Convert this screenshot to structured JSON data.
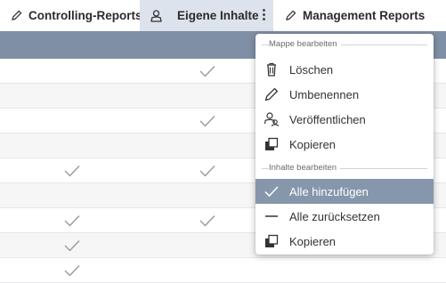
{
  "tabs": [
    {
      "label": "Controlling-Reports",
      "icon": "pencil-icon",
      "active": false
    },
    {
      "label": "Eigene Inhalte",
      "icon": "user-icon",
      "active": true
    },
    {
      "label": "Management Reports",
      "icon": "pencil-icon",
      "active": false
    }
  ],
  "grid": {
    "rows": [
      {
        "col1_checked": false,
        "col2_checked": true
      },
      {
        "col1_checked": false,
        "col2_checked": false
      },
      {
        "col1_checked": false,
        "col2_checked": true
      },
      {
        "col1_checked": false,
        "col2_checked": false
      },
      {
        "col1_checked": true,
        "col2_checked": true
      },
      {
        "col1_checked": false,
        "col2_checked": false
      },
      {
        "col1_checked": true,
        "col2_checked": true
      },
      {
        "col1_checked": true,
        "col2_checked": false
      },
      {
        "col1_checked": true,
        "col2_checked": false
      }
    ]
  },
  "menu": {
    "section1_title": "Mappe bearbeiten",
    "section1_items": [
      {
        "label": "Löschen",
        "icon": "trash-icon"
      },
      {
        "label": "Umbenennen",
        "icon": "pencil-icon"
      },
      {
        "label": "Veröffentlichen",
        "icon": "share-users-icon"
      },
      {
        "label": "Kopieren",
        "icon": "copy-icon"
      }
    ],
    "section2_title": "Inhalte bearbeiten",
    "section2_items": [
      {
        "label": "Alle hinzufügen",
        "icon": "check-icon",
        "selected": true
      },
      {
        "label": "Alle zurücksetzen",
        "icon": "minus-icon",
        "selected": false
      },
      {
        "label": "Kopieren",
        "icon": "copy-icon",
        "selected": false
      }
    ]
  },
  "colors": {
    "header_bg": "#7f8fa5",
    "active_tab_bg": "#dde3ec",
    "selected_item_bg": "#8696ab"
  }
}
